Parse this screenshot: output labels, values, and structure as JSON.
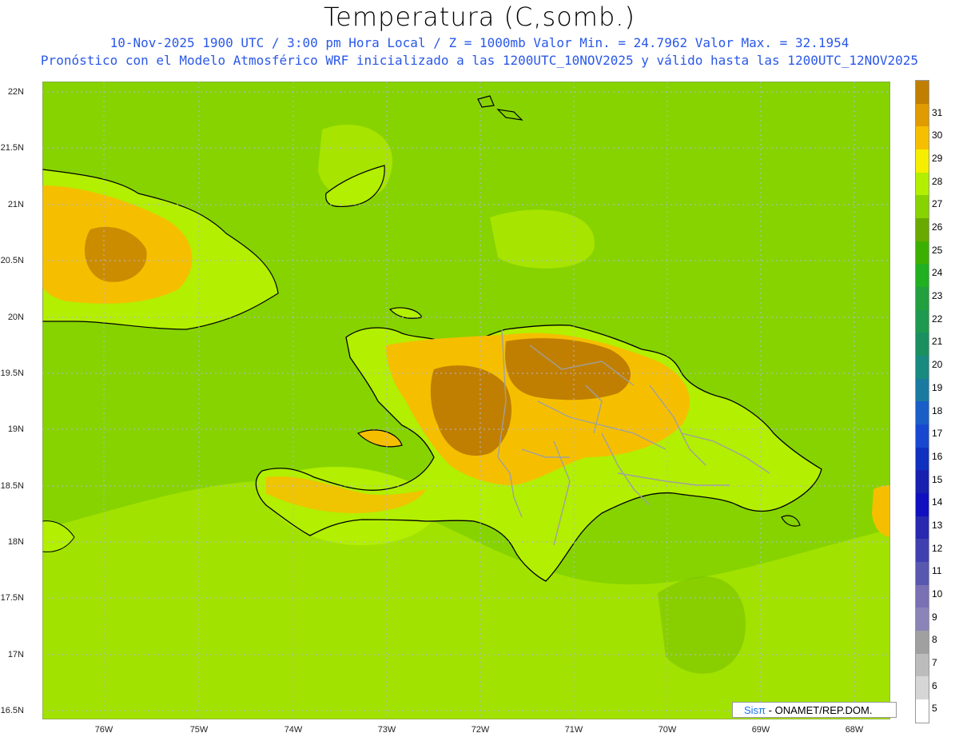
{
  "header": {
    "title": "Temperatura (C,somb.)",
    "line1": "10-Nov-2025  1900 UTC / 3:00 pm Hora Local / Z = 1000mb   Valor Min. = 24.7962  Valor Max. = 32.1954",
    "line2": "Pronóstico con el Modelo Atmosférico WRF inicializado a las 1200UTC_10NOV2025 y válido hasta las  1200UTC_12NOV2025"
  },
  "axes": {
    "lat_labels": [
      "22N",
      "21.5N",
      "21N",
      "20.5N",
      "20N",
      "19.5N",
      "19N",
      "18.5N",
      "18N",
      "17.5N",
      "17N",
      "16.5N"
    ],
    "lon_labels": [
      "76W",
      "75W",
      "74W",
      "73W",
      "72W",
      "71W",
      "70W",
      "69W",
      "68W"
    ]
  },
  "colorbar": {
    "labels": [
      "31",
      "30",
      "29",
      "28",
      "27",
      "26",
      "25",
      "24",
      "23",
      "22",
      "21",
      "20",
      "19",
      "18",
      "17",
      "16",
      "15",
      "14",
      "13",
      "12",
      "11",
      "10",
      "9",
      "8",
      "7",
      "6",
      "5"
    ],
    "colors": [
      "#c07f00",
      "#e09b00",
      "#f5bf00",
      "#f5ee00",
      "#b2ef00",
      "#86d300",
      "#6aaa00",
      "#3cb000",
      "#20b020",
      "#22a040",
      "#1e9a50",
      "#1a9060",
      "#188a80",
      "#1a7aa0",
      "#1a5ec8",
      "#1848d0",
      "#1030c0",
      "#1820b0",
      "#1010c0",
      "#2828b0",
      "#4040b0",
      "#5858b0",
      "#7a70b4",
      "#8a84b8",
      "#a0a0a0",
      "#bcbcbc",
      "#d6d6d6",
      "#ffffff"
    ]
  },
  "credit": {
    "brand": "Sisπ",
    "org": "- ONAMET/REP.DOM."
  }
}
